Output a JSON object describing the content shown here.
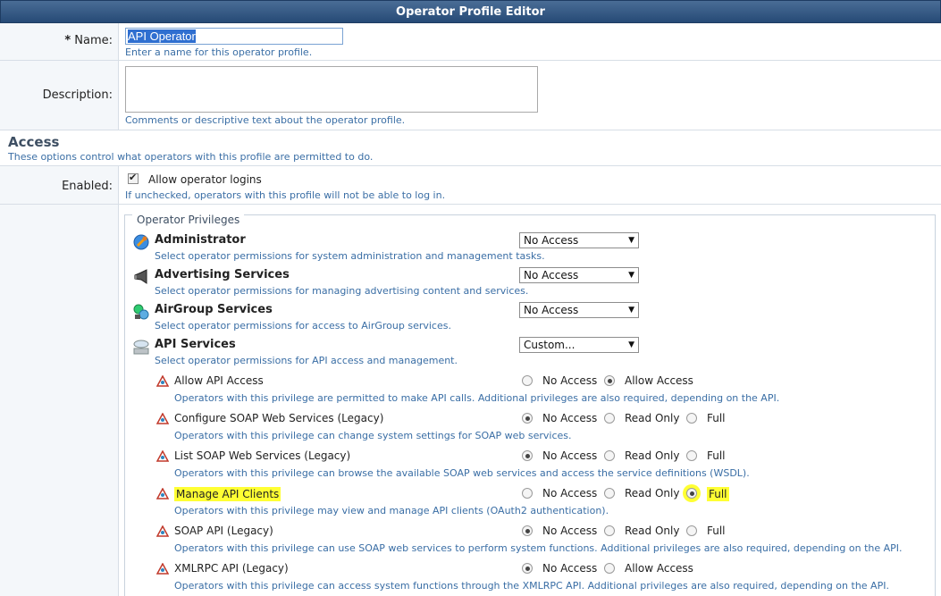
{
  "window": {
    "title": "Operator Profile Editor"
  },
  "name_field": {
    "required_mark": "*",
    "label": "Name:",
    "value": "API Operator",
    "help": "Enter a name for this operator profile."
  },
  "description_field": {
    "label": "Description:",
    "value": "",
    "help": "Comments or descriptive text about the operator profile."
  },
  "access": {
    "title": "Access",
    "help": "These options control what operators with this profile are permitted to do."
  },
  "enabled_field": {
    "label": "Enabled:",
    "checked": true,
    "checkbox_label": "Allow operator logins",
    "help": "If unchecked, operators with this profile will not be able to log in."
  },
  "privileges": {
    "legend": "Operator Privileges",
    "groups": [
      {
        "title": "Administrator",
        "help": "Select operator permissions for system administration and management tasks.",
        "selected": "No Access",
        "icon": "admin-icon"
      },
      {
        "title": "Advertising Services",
        "help": "Select operator permissions for managing advertising content and services.",
        "selected": "No Access",
        "icon": "megaphone-icon"
      },
      {
        "title": "AirGroup Services",
        "help": "Select operator permissions for access to AirGroup services.",
        "selected": "No Access",
        "icon": "airgroup-icon"
      },
      {
        "title": "API Services",
        "help": "Select operator permissions for API access and management.",
        "selected": "Custom...",
        "icon": "api-icon"
      }
    ],
    "api_items": [
      {
        "title": "Allow API Access",
        "help": "Operators with this privilege are permitted to make API calls. Additional privileges are also required, depending on the API.",
        "options": [
          "No Access",
          "Allow Access"
        ],
        "selected": "Allow Access"
      },
      {
        "title": "Configure SOAP Web Services (Legacy)",
        "help": "Operators with this privilege can change system settings for SOAP web services.",
        "options": [
          "No Access",
          "Read Only",
          "Full"
        ],
        "selected": "No Access"
      },
      {
        "title": "List SOAP Web Services (Legacy)",
        "help": "Operators with this privilege can browse the available SOAP web services and access the service definitions (WSDL).",
        "options": [
          "No Access",
          "Read Only",
          "Full"
        ],
        "selected": "No Access"
      },
      {
        "title": "Manage API Clients",
        "help": "Operators with this privilege may view and manage API clients (OAuth2 authentication).",
        "options": [
          "No Access",
          "Read Only",
          "Full"
        ],
        "selected": "Full"
      },
      {
        "title": "SOAP API (Legacy)",
        "help": "Operators with this privilege can use SOAP web services to perform system functions. Additional privileges are also required, depending on the API.",
        "options": [
          "No Access",
          "Read Only",
          "Full"
        ],
        "selected": "No Access"
      },
      {
        "title": "XMLRPC API (Legacy)",
        "help": "Operators with this privilege can access system functions through the XMLRPC API. Additional privileges are also required, depending on the API.",
        "options": [
          "No Access",
          "Allow Access"
        ],
        "selected": "No Access"
      }
    ]
  },
  "colors": {
    "title_bar": "#264a76",
    "help_text": "#3a6ea5",
    "highlight": "#ffff33"
  }
}
